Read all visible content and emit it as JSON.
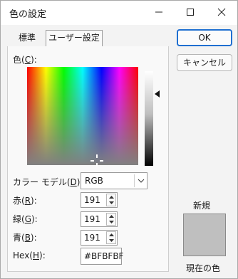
{
  "window": {
    "title": "色の設定"
  },
  "tabs": {
    "standard": "標準",
    "custom": "ユーザー設定"
  },
  "labels": {
    "color": "色(",
    "color_key": "C",
    "color_end": "):",
    "model": "カラー モデル(",
    "model_key": "D",
    "model_end": "):",
    "red": "赤(",
    "red_key": "R",
    "red_end": "):",
    "green": "緑(",
    "green_key": "G",
    "green_end": "):",
    "blue": "青(",
    "blue_key": "B",
    "blue_end": "):",
    "hex": "Hex(",
    "hex_key": "H",
    "hex_end": "):"
  },
  "fields": {
    "color_model": "RGB",
    "red": "191",
    "green": "191",
    "blue": "191",
    "hex": "#BFBFBF"
  },
  "buttons": {
    "ok": "OK",
    "cancel": "キャンセル"
  },
  "preview": {
    "new_label": "新規",
    "current_label": "現在の色",
    "color": "#BFBFBF"
  },
  "colors": {
    "accent": "#1F6FD1",
    "selected": "#BFBFBF"
  }
}
